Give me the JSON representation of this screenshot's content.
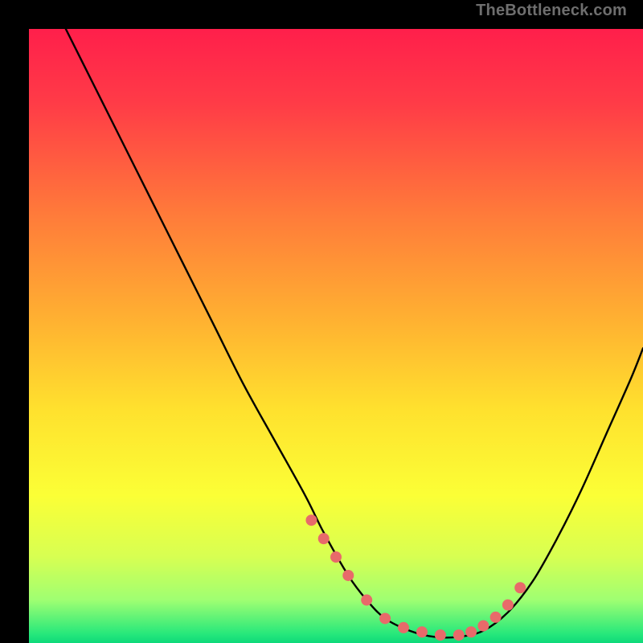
{
  "watermark": "TheBottleneck.com",
  "chart_data": {
    "type": "line",
    "title": "",
    "xlabel": "",
    "ylabel": "",
    "xlim": [
      0,
      100
    ],
    "ylim": [
      0,
      100
    ],
    "grid": false,
    "legend": false,
    "background_gradient": {
      "stops": [
        {
          "offset": 0.0,
          "color": "#ff1f4b"
        },
        {
          "offset": 0.12,
          "color": "#ff3b47"
        },
        {
          "offset": 0.3,
          "color": "#ff7a3a"
        },
        {
          "offset": 0.48,
          "color": "#ffb331"
        },
        {
          "offset": 0.62,
          "color": "#ffe12e"
        },
        {
          "offset": 0.76,
          "color": "#fbff36"
        },
        {
          "offset": 0.86,
          "color": "#d7ff52"
        },
        {
          "offset": 0.93,
          "color": "#9fff72"
        },
        {
          "offset": 0.985,
          "color": "#27e87b"
        },
        {
          "offset": 1.0,
          "color": "#0ed97a"
        }
      ]
    },
    "series": [
      {
        "name": "curve",
        "type": "line",
        "color": "#000000",
        "x": [
          6,
          10,
          15,
          20,
          25,
          30,
          35,
          40,
          45,
          48,
          52,
          55,
          58,
          62,
          66,
          70,
          74,
          78,
          82,
          86,
          90,
          94,
          98,
          100
        ],
        "y": [
          100,
          92,
          82,
          72,
          62,
          52,
          42,
          33,
          24,
          18,
          11,
          7,
          4,
          2,
          1,
          1,
          2,
          5,
          10,
          17,
          25,
          34,
          43,
          48
        ]
      },
      {
        "name": "markers",
        "type": "scatter",
        "color": "#e86a6a",
        "x": [
          46,
          48,
          50,
          52,
          55,
          58,
          61,
          64,
          67,
          70,
          72,
          74,
          76,
          78,
          80
        ],
        "y": [
          20,
          17,
          14,
          11,
          7,
          4,
          2.5,
          1.8,
          1.3,
          1.3,
          1.8,
          2.8,
          4.2,
          6.2,
          9
        ]
      }
    ]
  }
}
